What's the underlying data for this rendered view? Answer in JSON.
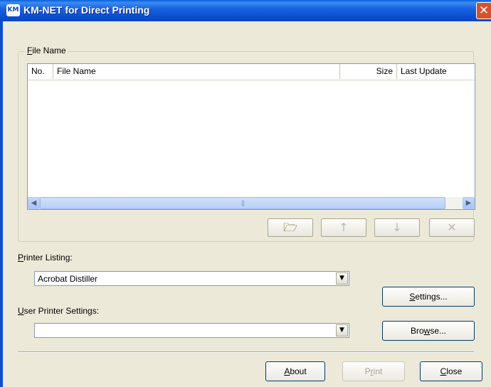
{
  "window": {
    "title": "KM-NET for Direct Printing",
    "app_icon_text": "KM",
    "close_glyph": "✕"
  },
  "file_group": {
    "label_mnemonic": "F",
    "label_rest": "ile Name",
    "columns": [
      "No.",
      "File Name",
      "Size",
      "Last Update"
    ],
    "rows": [],
    "scroll_thumb_grip": "|||"
  },
  "toolbar": {
    "open_icon": "open-folder-icon",
    "up_icon": "arrow-up-icon",
    "down_icon": "arrow-down-icon",
    "delete_icon": "delete-x-icon",
    "open_glyph": "🗁",
    "up_glyph": "↑",
    "down_glyph": "↓",
    "delete_glyph": "✕"
  },
  "printer_listing": {
    "label_mnemonic": "P",
    "label_rest": "rinter Listing:",
    "selected": "Acrobat Distiller"
  },
  "user_printer_settings": {
    "label_mnemonic": "U",
    "label_rest": "ser Printer Settings:",
    "selected": ""
  },
  "buttons": {
    "settings": {
      "mnemonic": "S",
      "rest": "ettings..."
    },
    "browse": {
      "pre": "Bro",
      "mnemonic": "w",
      "rest": "se..."
    },
    "about": {
      "mnemonic": "A",
      "rest": "bout"
    },
    "print": {
      "pre": "P",
      "mnemonic": "r",
      "rest": "int"
    },
    "close": {
      "mnemonic": "C",
      "rest": "lose"
    }
  },
  "combo_arrow_glyph": "▼",
  "scroll_left_glyph": "◀",
  "scroll_right_glyph": "▶"
}
